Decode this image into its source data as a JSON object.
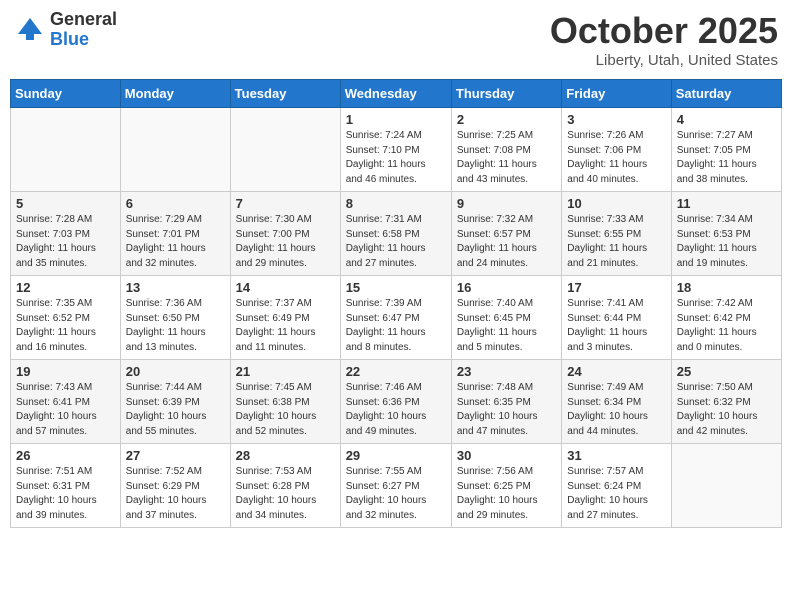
{
  "header": {
    "logo_general": "General",
    "logo_blue": "Blue",
    "month_title": "October 2025",
    "location": "Liberty, Utah, United States"
  },
  "days_of_week": [
    "Sunday",
    "Monday",
    "Tuesday",
    "Wednesday",
    "Thursday",
    "Friday",
    "Saturday"
  ],
  "weeks": [
    [
      {
        "day": "",
        "info": ""
      },
      {
        "day": "",
        "info": ""
      },
      {
        "day": "",
        "info": ""
      },
      {
        "day": "1",
        "info": "Sunrise: 7:24 AM\nSunset: 7:10 PM\nDaylight: 11 hours\nand 46 minutes."
      },
      {
        "day": "2",
        "info": "Sunrise: 7:25 AM\nSunset: 7:08 PM\nDaylight: 11 hours\nand 43 minutes."
      },
      {
        "day": "3",
        "info": "Sunrise: 7:26 AM\nSunset: 7:06 PM\nDaylight: 11 hours\nand 40 minutes."
      },
      {
        "day": "4",
        "info": "Sunrise: 7:27 AM\nSunset: 7:05 PM\nDaylight: 11 hours\nand 38 minutes."
      }
    ],
    [
      {
        "day": "5",
        "info": "Sunrise: 7:28 AM\nSunset: 7:03 PM\nDaylight: 11 hours\nand 35 minutes."
      },
      {
        "day": "6",
        "info": "Sunrise: 7:29 AM\nSunset: 7:01 PM\nDaylight: 11 hours\nand 32 minutes."
      },
      {
        "day": "7",
        "info": "Sunrise: 7:30 AM\nSunset: 7:00 PM\nDaylight: 11 hours\nand 29 minutes."
      },
      {
        "day": "8",
        "info": "Sunrise: 7:31 AM\nSunset: 6:58 PM\nDaylight: 11 hours\nand 27 minutes."
      },
      {
        "day": "9",
        "info": "Sunrise: 7:32 AM\nSunset: 6:57 PM\nDaylight: 11 hours\nand 24 minutes."
      },
      {
        "day": "10",
        "info": "Sunrise: 7:33 AM\nSunset: 6:55 PM\nDaylight: 11 hours\nand 21 minutes."
      },
      {
        "day": "11",
        "info": "Sunrise: 7:34 AM\nSunset: 6:53 PM\nDaylight: 11 hours\nand 19 minutes."
      }
    ],
    [
      {
        "day": "12",
        "info": "Sunrise: 7:35 AM\nSunset: 6:52 PM\nDaylight: 11 hours\nand 16 minutes."
      },
      {
        "day": "13",
        "info": "Sunrise: 7:36 AM\nSunset: 6:50 PM\nDaylight: 11 hours\nand 13 minutes."
      },
      {
        "day": "14",
        "info": "Sunrise: 7:37 AM\nSunset: 6:49 PM\nDaylight: 11 hours\nand 11 minutes."
      },
      {
        "day": "15",
        "info": "Sunrise: 7:39 AM\nSunset: 6:47 PM\nDaylight: 11 hours\nand 8 minutes."
      },
      {
        "day": "16",
        "info": "Sunrise: 7:40 AM\nSunset: 6:45 PM\nDaylight: 11 hours\nand 5 minutes."
      },
      {
        "day": "17",
        "info": "Sunrise: 7:41 AM\nSunset: 6:44 PM\nDaylight: 11 hours\nand 3 minutes."
      },
      {
        "day": "18",
        "info": "Sunrise: 7:42 AM\nSunset: 6:42 PM\nDaylight: 11 hours\nand 0 minutes."
      }
    ],
    [
      {
        "day": "19",
        "info": "Sunrise: 7:43 AM\nSunset: 6:41 PM\nDaylight: 10 hours\nand 57 minutes."
      },
      {
        "day": "20",
        "info": "Sunrise: 7:44 AM\nSunset: 6:39 PM\nDaylight: 10 hours\nand 55 minutes."
      },
      {
        "day": "21",
        "info": "Sunrise: 7:45 AM\nSunset: 6:38 PM\nDaylight: 10 hours\nand 52 minutes."
      },
      {
        "day": "22",
        "info": "Sunrise: 7:46 AM\nSunset: 6:36 PM\nDaylight: 10 hours\nand 49 minutes."
      },
      {
        "day": "23",
        "info": "Sunrise: 7:48 AM\nSunset: 6:35 PM\nDaylight: 10 hours\nand 47 minutes."
      },
      {
        "day": "24",
        "info": "Sunrise: 7:49 AM\nSunset: 6:34 PM\nDaylight: 10 hours\nand 44 minutes."
      },
      {
        "day": "25",
        "info": "Sunrise: 7:50 AM\nSunset: 6:32 PM\nDaylight: 10 hours\nand 42 minutes."
      }
    ],
    [
      {
        "day": "26",
        "info": "Sunrise: 7:51 AM\nSunset: 6:31 PM\nDaylight: 10 hours\nand 39 minutes."
      },
      {
        "day": "27",
        "info": "Sunrise: 7:52 AM\nSunset: 6:29 PM\nDaylight: 10 hours\nand 37 minutes."
      },
      {
        "day": "28",
        "info": "Sunrise: 7:53 AM\nSunset: 6:28 PM\nDaylight: 10 hours\nand 34 minutes."
      },
      {
        "day": "29",
        "info": "Sunrise: 7:55 AM\nSunset: 6:27 PM\nDaylight: 10 hours\nand 32 minutes."
      },
      {
        "day": "30",
        "info": "Sunrise: 7:56 AM\nSunset: 6:25 PM\nDaylight: 10 hours\nand 29 minutes."
      },
      {
        "day": "31",
        "info": "Sunrise: 7:57 AM\nSunset: 6:24 PM\nDaylight: 10 hours\nand 27 minutes."
      },
      {
        "day": "",
        "info": ""
      }
    ]
  ]
}
